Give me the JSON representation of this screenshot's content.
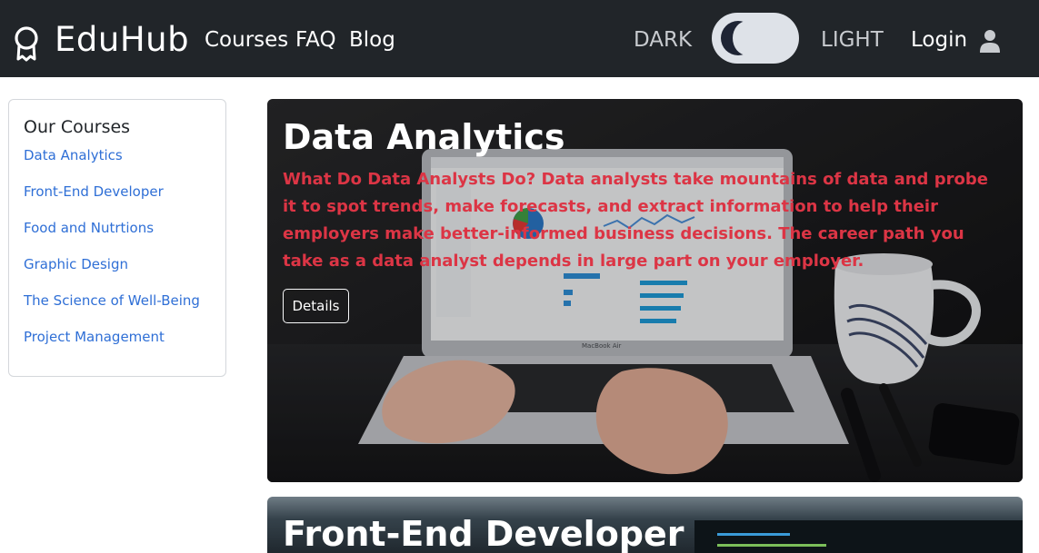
{
  "navbar": {
    "brand": "EduHub",
    "links": [
      "Courses",
      "FAQ",
      "Blog"
    ],
    "theme": {
      "dark_label": "DARK",
      "light_label": "LIGHT"
    },
    "login_label": "Login"
  },
  "sidebar": {
    "title": "Our Courses",
    "items": [
      "Data Analytics",
      "Front-End Developer",
      "Food and Nutrtions",
      "Graphic Design",
      "The Science of Well-Being",
      "Project Management"
    ]
  },
  "courses": [
    {
      "title": "Data Analytics",
      "description": "What Do Data Analysts Do? Data analysts take mountains of data and probe it to spot trends, make forecasts, and extract information to help their employers make better-informed business decisions. The career path you take as a data analyst depends in large part on your employer.",
      "button_label": "Details",
      "laptop_label": "MacBook Air"
    },
    {
      "title": "Front-End Developer"
    }
  ],
  "colors": {
    "navbar_bg": "#212529",
    "link": "#2f6fd6",
    "course_text": "#dc3545"
  }
}
